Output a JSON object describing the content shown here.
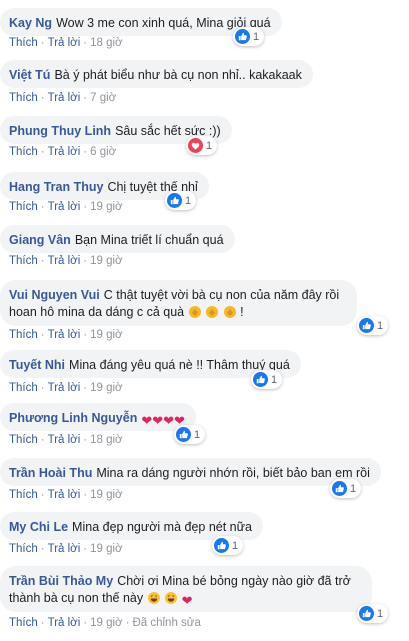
{
  "comments": [
    {
      "author": "Kay Ng",
      "text": "Wow 3 me con xinh quá, Mina giỏi quá",
      "like": "Thích",
      "reply": "Trả lời",
      "time": "18 giờ",
      "reaction": {
        "icon": "like-icon",
        "count": "1"
      }
    },
    {
      "author": "Việt Tú",
      "text": "Bà ý phát biểu như bà cụ non nhỉ.. kakakaak",
      "like": "Thích",
      "reply": "Trả lời",
      "time": "7 giờ"
    },
    {
      "author": "Phung Thuy Linh",
      "text": "Sâu sắc hết sức :))",
      "like": "Thích",
      "reply": "Trả lời",
      "time": "6 giờ",
      "reaction": {
        "icon": "heart-icon",
        "count": "1"
      }
    },
    {
      "author": "Hang Tran Thuy",
      "text": "Chị tuyệt thế nhỉ",
      "like": "Thích",
      "reply": "Trả lời",
      "time": "19 giờ",
      "reaction": {
        "icon": "like-icon",
        "count": "1"
      }
    },
    {
      "author": "Giang Vân",
      "text": "Bạn Mina triết lí chuẩn quá",
      "like": "Thích",
      "reply": "Trả lời",
      "time": "19 giờ"
    },
    {
      "author": "Vui Nguyen Vui",
      "text": "C thật tuyệt vời bà cụ non của năm đây rồi hoan hô mina da dáng c cả quà",
      "suffix": "!",
      "like": "Thích",
      "reply": "Trả lời",
      "time": "19 giờ",
      "reaction": {
        "icon": "like-icon",
        "count": "1"
      }
    },
    {
      "author": "Tuyết Nhi",
      "text": "Mina đáng yêu quá nè !! Thâm thuý quá",
      "like": "Thích",
      "reply": "Trả lời",
      "time": "19 giờ",
      "reaction": {
        "icon": "like-icon",
        "count": "1"
      }
    },
    {
      "author": "Phương Linh Nguyễn",
      "text": "",
      "like": "Thích",
      "reply": "Trả lời",
      "time": "18 giờ",
      "reaction": {
        "icon": "like-icon",
        "count": "1"
      }
    },
    {
      "author": "Trần Hoài Thu",
      "text": "Mina ra dáng người nhớn rồi, biết bảo ban em rồi",
      "like": "Thích",
      "reply": "Trả lời",
      "time": "19 giờ",
      "reaction": {
        "icon": "like-icon",
        "count": "1"
      }
    },
    {
      "author": "My Chi Le",
      "text": "Mina đẹp người mà đẹp nét nữa",
      "like": "Thích",
      "reply": "Trả lời",
      "time": "19 giờ",
      "reaction": {
        "icon": "like-icon",
        "count": "1"
      }
    },
    {
      "author": "Trần Bùi Thảo My",
      "text": "Chời ơi Mina bé bỏng ngày nào giờ đã trở thành bà cụ non thế này",
      "like": "Thích",
      "reply": "Trả lời",
      "time": "19 giờ",
      "edited": "Đã chỉnh sửa",
      "reaction": {
        "icon": "like-icon",
        "count": "1"
      }
    }
  ],
  "colors": {
    "author": "#385898",
    "bubble": "#f2f3f5",
    "like": "#1877f2",
    "heart": "#f33e58"
  }
}
